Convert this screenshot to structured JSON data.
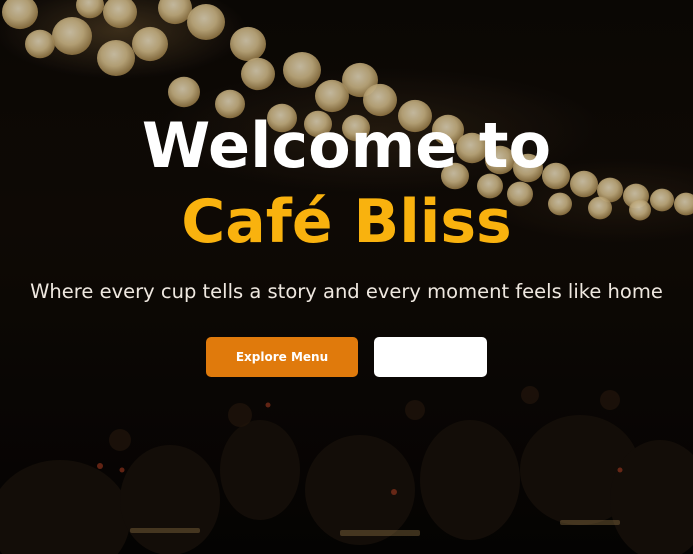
{
  "hero": {
    "title_line1": "Welcome to",
    "title_line2": "Café Bliss",
    "subtitle": "Where every cup tells a story and every moment feels like home",
    "primary_button_label": "Explore Menu",
    "secondary_button_label": ""
  },
  "colors": {
    "accent": "#f9b20e",
    "primary_button": "#e07a0c",
    "secondary_button": "#ffffff",
    "title": "#ffffff",
    "background": "#0a0704"
  }
}
